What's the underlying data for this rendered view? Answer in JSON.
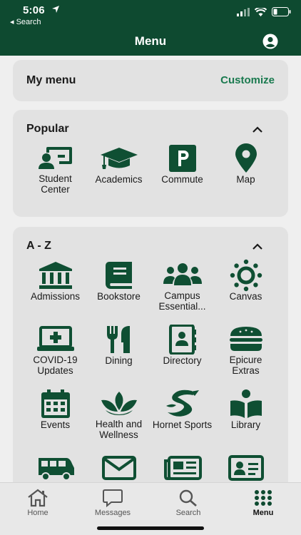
{
  "status": {
    "time": "5:06",
    "back_label": "◂ Search"
  },
  "header": {
    "title": "Menu"
  },
  "my_menu": {
    "title": "My menu",
    "customize": "Customize"
  },
  "popular": {
    "title": "Popular",
    "items": [
      {
        "label": "Student Center",
        "icon": "student-center-icon"
      },
      {
        "label": "Academics",
        "icon": "graduation-cap-icon"
      },
      {
        "label": "Commute",
        "icon": "parking-icon"
      },
      {
        "label": "Map",
        "icon": "map-pin-icon"
      }
    ]
  },
  "az": {
    "title": "A - Z",
    "items": [
      {
        "label": "Admissions",
        "icon": "institution-icon"
      },
      {
        "label": "Bookstore",
        "icon": "book-icon"
      },
      {
        "label": "Campus Essential...",
        "icon": "people-group-icon"
      },
      {
        "label": "Canvas",
        "icon": "canvas-icon"
      },
      {
        "label": "COVID-19 Updates",
        "icon": "laptop-medical-icon"
      },
      {
        "label": "Dining",
        "icon": "utensils-icon"
      },
      {
        "label": "Directory",
        "icon": "address-book-icon"
      },
      {
        "label": "Epicure Extras",
        "icon": "burger-icon"
      },
      {
        "label": "Events",
        "icon": "calendar-icon"
      },
      {
        "label": "Health and Wellness",
        "icon": "lotus-icon"
      },
      {
        "label": "Hornet Sports",
        "icon": "hornet-logo-icon"
      },
      {
        "label": "Library",
        "icon": "open-book-icon"
      },
      {
        "label": "",
        "icon": "van-icon"
      },
      {
        "label": "",
        "icon": "mail-icon"
      },
      {
        "label": "",
        "icon": "newspaper-icon"
      },
      {
        "label": "",
        "icon": "id-card-icon"
      }
    ]
  },
  "tabs": [
    {
      "label": "Home",
      "icon": "home-icon"
    },
    {
      "label": "Messages",
      "icon": "chat-icon"
    },
    {
      "label": "Search",
      "icon": "search-icon"
    },
    {
      "label": "Menu",
      "icon": "grid-dots-icon"
    }
  ],
  "colors": {
    "brand": "#0e4a30",
    "accent": "#1a7a4f",
    "icon": "#0f4f33"
  }
}
